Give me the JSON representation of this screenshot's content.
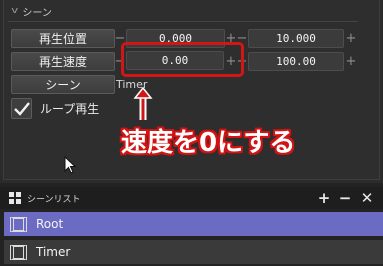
{
  "scene_section": {
    "title": "シーン",
    "play_position": {
      "label": "再生位置",
      "start": "0.000",
      "end": "10.000"
    },
    "play_speed": {
      "label": "再生速度",
      "start": "0.00",
      "end": "100.00"
    },
    "scene": {
      "label": "シーン",
      "value": "Timer"
    },
    "loop_play": {
      "label": "ループ再生",
      "checked": true
    }
  },
  "annotation": {
    "text": "速度を0にする",
    "arrow": "↑"
  },
  "scene_list": {
    "title": "シーンリスト",
    "controls": {
      "add": "+",
      "remove": "−",
      "close": "✕"
    },
    "items": [
      {
        "label": "Root",
        "selected": true
      },
      {
        "label": "Timer",
        "selected": false
      }
    ]
  },
  "colors": {
    "accent_red": "#d21515",
    "selection": "#6b6bc4"
  }
}
